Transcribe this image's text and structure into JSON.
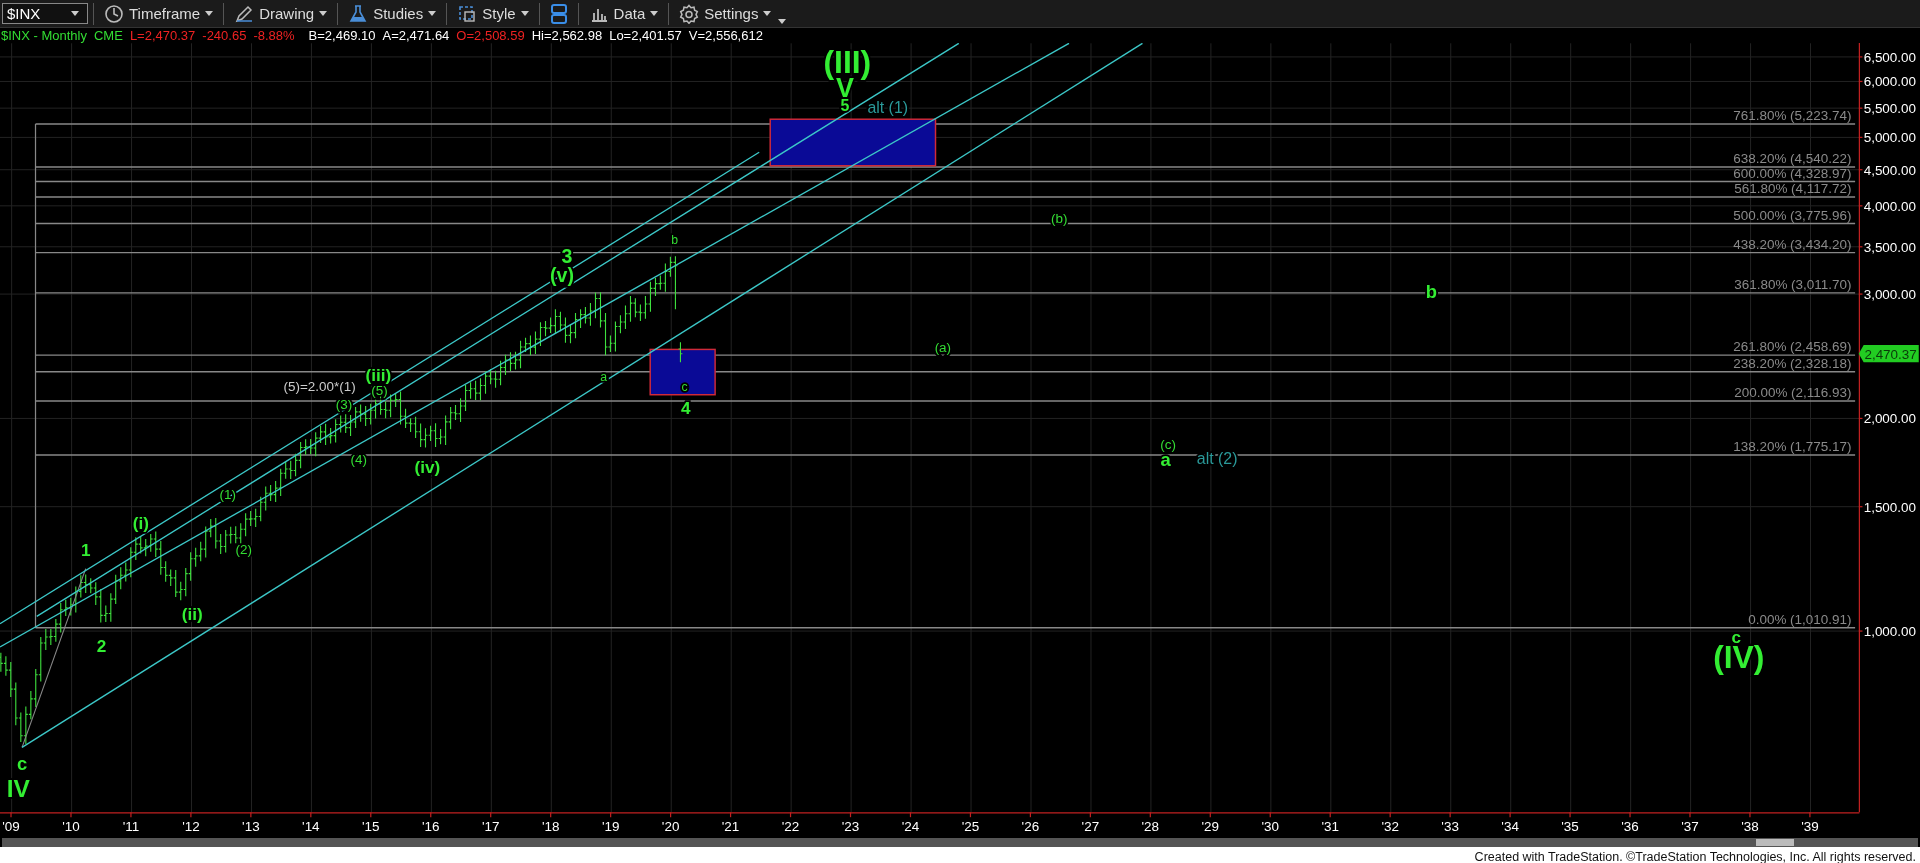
{
  "toolbar": {
    "symbol": "$INX",
    "buttons": [
      {
        "kind": "labeled",
        "label": "Timeframe"
      },
      {
        "kind": "labeled",
        "label": "Drawing"
      },
      {
        "kind": "labeled",
        "label": "Studies"
      },
      {
        "kind": "labeled",
        "label": "Style"
      },
      {
        "kind": "icon"
      },
      {
        "kind": "labeled",
        "label": "Data"
      },
      {
        "kind": "labeled",
        "label": "Settings"
      }
    ]
  },
  "info_bar": [
    {
      "text": "$INX - Monthly",
      "color": "#33dd33"
    },
    {
      "text": "CME",
      "color": "#33dd33"
    },
    {
      "text": "L=2,470.37",
      "color": "#ee2222"
    },
    {
      "text": "-240.65",
      "color": "#ee2222"
    },
    {
      "text": "-8.88%",
      "color": "#ee2222"
    },
    {
      "text": "B=2,469.10",
      "color": "#ffffff"
    },
    {
      "text": "A=2,471.64",
      "color": "#ffffff"
    },
    {
      "text": "O=2,508.59",
      "color": "#ee2222"
    },
    {
      "text": "Hi=2,562.98",
      "color": "#ffffff"
    },
    {
      "text": "Lo=2,401.57",
      "color": "#ffffff"
    },
    {
      "text": "V=2,556,612",
      "color": "#ffffff"
    }
  ],
  "chart": {
    "fib_levels": [
      {
        "label": "761.80% (5,223.74)"
      },
      {
        "label": "638.20% (4,540.22)"
      },
      {
        "label": "600.00% (4,328.97)"
      },
      {
        "label": "561.80% (4,117.72)"
      },
      {
        "label": "500.00% (3,775.96)"
      },
      {
        "label": "438.20% (3,434.20)"
      },
      {
        "label": "361.80% (3,011.70)"
      },
      {
        "label": "261.80% (2,458.69)"
      },
      {
        "label": "238.20% (2,328.18)"
      },
      {
        "label": "200.00% (2,116.93)"
      },
      {
        "label": "138.20% (1,775.17)"
      },
      {
        "label": "0.00% (1,010.91)"
      }
    ],
    "price_axis": [
      "6,500.00",
      "6,000.00",
      "5,500.00",
      "5,000.00",
      "4,500.00",
      "4,000.00",
      "3,500.00",
      "3,000.00",
      "2,000.00",
      "1,500.00",
      "1,000.00"
    ],
    "last_price": "2,470.37",
    "year_axis": [
      "'09",
      "'10",
      "'11",
      "'12",
      "'13",
      "'14",
      "'15",
      "'16",
      "'17",
      "'18",
      "'19",
      "'20",
      "'21",
      "'22",
      "'23",
      "'24",
      "'25",
      "'26",
      "'27",
      "'28",
      "'29",
      "'30",
      "'31",
      "'32",
      "'33",
      "'34",
      "'35",
      "'36",
      "'37",
      "'38",
      "'39"
    ],
    "wave_labels": [
      {
        "text": "(III)",
        "kind": "bold",
        "color": "#33ee33"
      },
      {
        "text": "V",
        "kind": "bold",
        "color": "#33ee33"
      },
      {
        "text": "5",
        "kind": "bold",
        "color": "#33ee33"
      },
      {
        "text": "alt (1)",
        "kind": "plain",
        "color": "#2a9a9a"
      },
      {
        "text": "(b)",
        "kind": "plain",
        "color": "#33dd33"
      },
      {
        "text": "b",
        "kind": "bold",
        "color": "#33ee33"
      },
      {
        "text": "(a)",
        "kind": "plain",
        "color": "#33dd33"
      },
      {
        "text": "(c)",
        "kind": "plain",
        "color": "#33dd33"
      },
      {
        "text": "a",
        "kind": "bold",
        "color": "#33ee33"
      },
      {
        "text": "alt (2)",
        "kind": "plain",
        "color": "#2a9a9a"
      },
      {
        "text": "c",
        "kind": "bold",
        "color": "#33ee33"
      },
      {
        "text": "(IV)",
        "kind": "bold",
        "color": "#33ee33"
      },
      {
        "text": "3",
        "kind": "bold",
        "color": "#33ee33"
      },
      {
        "text": "(v)",
        "kind": "bold",
        "color": "#33ee33"
      },
      {
        "text": "b",
        "kind": "plain",
        "color": "#33dd33"
      },
      {
        "text": "a",
        "kind": "plain",
        "color": "#33dd33"
      },
      {
        "text": "c",
        "kind": "plain",
        "color": "#33dd33"
      },
      {
        "text": "4",
        "kind": "bold",
        "color": "#33ee33"
      },
      {
        "text": "(5)=2.00*(1)",
        "kind": "plain",
        "color": "#cccccc"
      },
      {
        "text": "(iii)",
        "kind": "bold",
        "color": "#33ee33"
      },
      {
        "text": "(5)",
        "kind": "plain",
        "color": "#33dd33"
      },
      {
        "text": "(3)",
        "kind": "plain",
        "color": "#33dd33"
      },
      {
        "text": "(4)",
        "kind": "plain",
        "color": "#33dd33"
      },
      {
        "text": "(iv)",
        "kind": "bold",
        "color": "#33ee33"
      },
      {
        "text": "(1)",
        "kind": "plain",
        "color": "#33dd33"
      },
      {
        "text": "(i)",
        "kind": "bold",
        "color": "#33ee33"
      },
      {
        "text": "(2)",
        "kind": "plain",
        "color": "#33dd33"
      },
      {
        "text": "1",
        "kind": "bold",
        "color": "#33ee33"
      },
      {
        "text": "(ii)",
        "kind": "bold",
        "color": "#33ee33"
      },
      {
        "text": "2",
        "kind": "bold",
        "color": "#33ee33"
      },
      {
        "text": "c",
        "kind": "bold",
        "color": "#33ee33"
      },
      {
        "text": "IV",
        "kind": "bold",
        "color": "#33ee33"
      }
    ]
  },
  "footer": "Created with TradeStation. ©TradeStation Technologies, Inc. All rights reserved."
}
